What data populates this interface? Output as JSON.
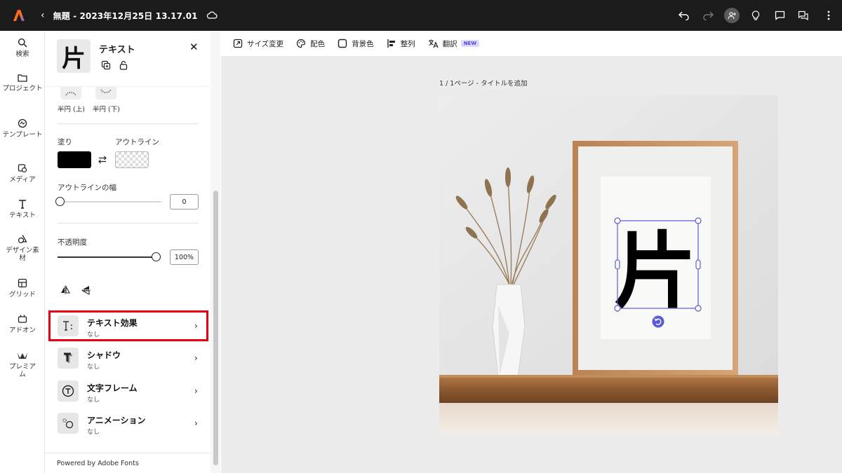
{
  "topbar": {
    "title": "無題 - 2023年12月25日 13.17.01"
  },
  "rail": [
    {
      "label": "検索",
      "icon": "search-icon"
    },
    {
      "label": "プロジェクト",
      "icon": "folder-icon"
    },
    {
      "label": "テンプレート",
      "icon": "template-icon"
    },
    {
      "label": "メディア",
      "icon": "media-icon"
    },
    {
      "label": "テキスト",
      "icon": "text-icon"
    },
    {
      "label": "デザイン素材",
      "icon": "shapes-icon"
    },
    {
      "label": "グリッド",
      "icon": "grid-icon"
    },
    {
      "label": "アドオン",
      "icon": "addon-icon"
    },
    {
      "label": "プレミアム",
      "icon": "premium-crown-icon"
    }
  ],
  "panel": {
    "title": "テキスト",
    "thumb_char": "片",
    "curve": {
      "top_label": "半円 (上)",
      "bottom_label": "半円 (下)"
    },
    "fill_label": "塗り",
    "outline_label": "アウトライン",
    "fill_color": "#000000",
    "outline_width_label": "アウトラインの幅",
    "outline_width_value": "0",
    "outline_width_level": 0,
    "opacity_label": "不透明度",
    "opacity_value": "100%",
    "opacity_level": 1.0,
    "effects": [
      {
        "name": "テキスト効果",
        "sub": "なし",
        "icon": "text-effects-icon"
      },
      {
        "name": "シャドウ",
        "sub": "なし",
        "icon": "shadow-icon"
      },
      {
        "name": "文字フレーム",
        "sub": "なし",
        "icon": "text-frame-icon"
      },
      {
        "name": "アニメーション",
        "sub": "なし",
        "icon": "animation-icon"
      }
    ],
    "footer": "Powered by Adobe Fonts"
  },
  "toolbar": {
    "resize": "サイズ変更",
    "color": "配色",
    "background": "背景色",
    "align": "整列",
    "translate": "翻訳",
    "new_badge": "NEW"
  },
  "canvas": {
    "page_label": "1 / 1ページ - タイトルを追加",
    "selected_text": "片"
  },
  "colors": {
    "highlight": "#e60012",
    "selection": "#5b5bd6",
    "topbar": "#1b1b1b"
  }
}
